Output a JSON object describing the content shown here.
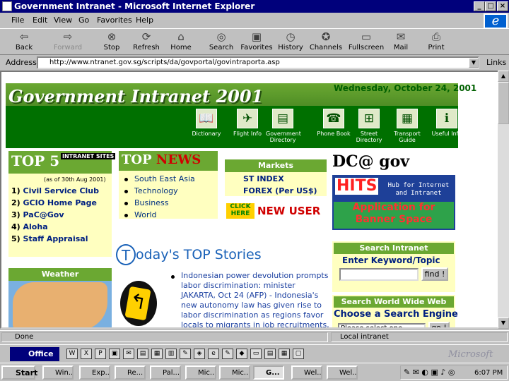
{
  "window": {
    "title": "Government Intranet - Microsoft Internet Explorer"
  },
  "menu": [
    "File",
    "Edit",
    "View",
    "Go",
    "Favorites",
    "Help"
  ],
  "toolbar": [
    {
      "label": "Back",
      "icon": "back-arrow-icon",
      "enabled": true
    },
    {
      "label": "Forward",
      "icon": "forward-arrow-icon",
      "enabled": false
    },
    {
      "label": "Stop",
      "icon": "stop-icon",
      "enabled": true
    },
    {
      "label": "Refresh",
      "icon": "refresh-icon",
      "enabled": true
    },
    {
      "label": "Home",
      "icon": "home-icon",
      "enabled": true
    },
    {
      "label": "Search",
      "icon": "search-icon",
      "enabled": true
    },
    {
      "label": "Favorites",
      "icon": "favorites-icon",
      "enabled": true
    },
    {
      "label": "History",
      "icon": "history-icon",
      "enabled": true
    },
    {
      "label": "Channels",
      "icon": "channels-icon",
      "enabled": true
    },
    {
      "label": "Fullscreen",
      "icon": "fullscreen-icon",
      "enabled": true
    },
    {
      "label": "Mail",
      "icon": "mail-icon",
      "enabled": true
    },
    {
      "label": "Print",
      "icon": "print-icon",
      "enabled": true
    }
  ],
  "address": {
    "label": "Address",
    "url": "http://www.ntranet.gov.sg/scripts/da/govportal/govintraporta.asp",
    "links": "Links"
  },
  "page": {
    "title": "Government Intranet 2001",
    "date": "Wednesday, October 24, 2001",
    "nav": [
      {
        "label": "Dictionary",
        "icon": "book-icon"
      },
      {
        "label": "Flight Info",
        "icon": "plane-icon"
      },
      {
        "label": "Government Directory",
        "icon": "directory-icon"
      },
      {
        "label": "Phone Book",
        "icon": "phone-icon"
      },
      {
        "label": "Street Directory",
        "icon": "street-icon"
      },
      {
        "label": "Transport Guide",
        "icon": "bus-icon"
      },
      {
        "label": "Useful Info",
        "icon": "info-icon"
      }
    ],
    "top5": {
      "heading": "TOP 5",
      "sub": "INTRANET SITES",
      "asof": "(as of 30th Aug 2001)",
      "items": [
        "Civil Service Club",
        "GCIO Home Page",
        "PaC@Gov",
        "Aloha",
        "Staff Appraisal"
      ]
    },
    "topnews": {
      "heading_a": "TOP",
      "heading_b": "NEWS",
      "items": [
        "South East Asia",
        "Technology",
        "Business",
        "World"
      ]
    },
    "markets": {
      "heading": "Markets",
      "items": [
        "ST INDEX",
        "FOREX (Per US$)"
      ]
    },
    "newuser": {
      "click": "CLICK HERE",
      "label": "NEW USER"
    },
    "dcgov": "DC@ gov",
    "hits": {
      "big": "HITS",
      "small": "Hub for Internet and Intranet",
      "app": "Application for Banner Space"
    },
    "todays": {
      "heading": "oday's TOP Stories",
      "story": "Indonesian power devolution prompts labor discrimination: minister JAKARTA, Oct 24 (AFP) - Indonesia's new autonomy law has given rise to labor discrimination as regions favor locals to migrants in job recruitments, a"
    },
    "weather": {
      "heading": "Weather"
    },
    "search": {
      "heading": "Search Intranet",
      "label": "Enter Keyword/Topic",
      "button": "find !"
    },
    "www": {
      "heading": "Search World Wide Web",
      "label": "Choose a Search Engine",
      "select": "Please select one",
      "button": "go !"
    }
  },
  "status": {
    "left": "Done",
    "right": "Local intranet"
  },
  "office": {
    "label": "Office",
    "brand": "Microsoft"
  },
  "taskbar": {
    "start": "Start",
    "tasks": [
      "Win...",
      "Exp...",
      "Re...",
      "Pal...",
      "Mic...",
      "Mic...",
      "G...",
      "Wel...",
      "Wel..."
    ],
    "active_index": 6,
    "clock": "6:07 PM"
  }
}
